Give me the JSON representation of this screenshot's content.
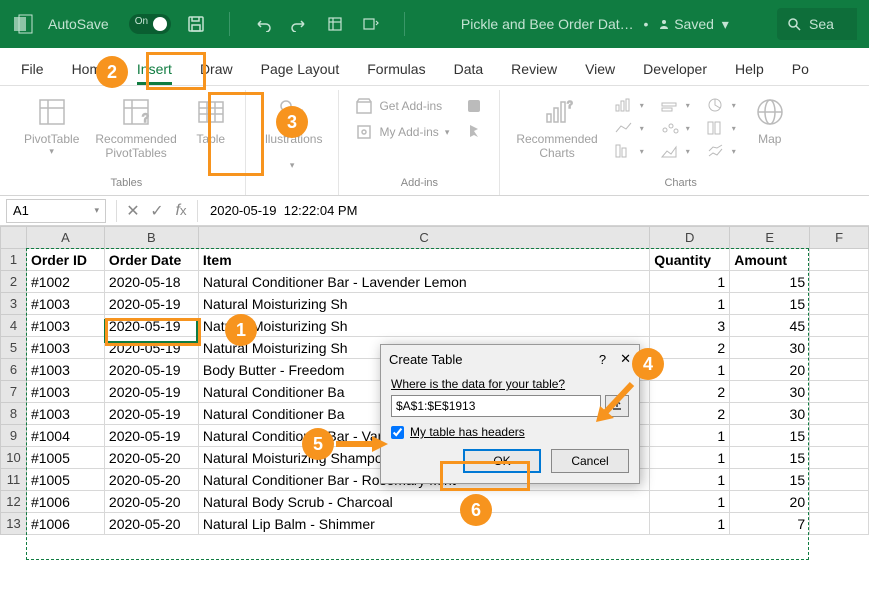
{
  "titlebar": {
    "autosave_label": "AutoSave",
    "autosave_toggle": "On",
    "filename": "Pickle and Bee Order Dat…",
    "saved_status": "Saved",
    "search_label": "Sea"
  },
  "menu": {
    "tabs": [
      "File",
      "Home",
      "Insert",
      "Draw",
      "Page Layout",
      "Formulas",
      "Data",
      "Review",
      "View",
      "Developer",
      "Help",
      "Po"
    ],
    "active_index": 2
  },
  "ribbon": {
    "groups": [
      {
        "label": "Tables",
        "buttons": [
          {
            "name": "pivottable",
            "label": "PivotTable"
          },
          {
            "name": "recommended-pivottables",
            "label": "Recommended\nPivotTables"
          },
          {
            "name": "table",
            "label": "Table"
          }
        ]
      },
      {
        "label": "",
        "buttons": [
          {
            "name": "illustrations",
            "label": "Illustrations"
          }
        ]
      },
      {
        "label": "Add-ins",
        "small": [
          {
            "name": "get-addins",
            "label": "Get Add-ins"
          },
          {
            "name": "my-addins",
            "label": "My Add-ins"
          }
        ]
      },
      {
        "label": "Charts",
        "buttons": [
          {
            "name": "recommended-charts",
            "label": "Recommended\nCharts"
          }
        ],
        "extra": [
          {
            "name": "maps",
            "label": "Map"
          }
        ]
      }
    ]
  },
  "formula_bar": {
    "name_box": "A1",
    "formula": "2020-05-19  12:22:04 PM"
  },
  "columns": [
    "",
    "A",
    "B",
    "C",
    "D",
    "E",
    "F"
  ],
  "headers": [
    "Order ID",
    "Order Date",
    "Item",
    "Quantity",
    "Amount"
  ],
  "rows": [
    {
      "n": 2,
      "id": "#1002",
      "date": "2020-05-18",
      "item": "Natural Conditioner Bar - Lavender Lemon",
      "qty": 1,
      "amt": 15
    },
    {
      "n": 3,
      "id": "#1003",
      "date": "2020-05-19",
      "item": "Natural Moisturizing Sh",
      "qty": 1,
      "amt": 15
    },
    {
      "n": 4,
      "id": "#1003",
      "date": "2020-05-19",
      "item": "Natural Moisturizing Sh",
      "qty": 3,
      "amt": 45
    },
    {
      "n": 5,
      "id": "#1003",
      "date": "2020-05-19",
      "item": "Natural Moisturizing Sh",
      "qty": 2,
      "amt": 30
    },
    {
      "n": 6,
      "id": "#1003",
      "date": "2020-05-19",
      "item": "Body Butter - Freedom",
      "qty": 1,
      "amt": 20
    },
    {
      "n": 7,
      "id": "#1003",
      "date": "2020-05-19",
      "item": "Natural Conditioner Ba",
      "qty": 2,
      "amt": 30
    },
    {
      "n": 8,
      "id": "#1003",
      "date": "2020-05-19",
      "item": "Natural Conditioner Ba",
      "qty": 2,
      "amt": 30
    },
    {
      "n": 9,
      "id": "#1004",
      "date": "2020-05-19",
      "item": "Natural Conditioner Bar - Vanilla Citrus",
      "qty": 1,
      "amt": 15
    },
    {
      "n": 10,
      "id": "#1005",
      "date": "2020-05-20",
      "item": "Natural Moisturizing Shampoo Bar - Tea Tree",
      "qty": 1,
      "amt": 15
    },
    {
      "n": 11,
      "id": "#1005",
      "date": "2020-05-20",
      "item": "Natural Conditioner Bar - Rosemary Mint",
      "qty": 1,
      "amt": 15
    },
    {
      "n": 12,
      "id": "#1006",
      "date": "2020-05-20",
      "item": "Natural Body Scrub - Charcoal",
      "qty": 1,
      "amt": 20
    },
    {
      "n": 13,
      "id": "#1006",
      "date": "2020-05-20",
      "item": "Natural Lip Balm - Shimmer",
      "qty": 1,
      "amt": 7
    }
  ],
  "dialog": {
    "title": "Create Table",
    "prompt": "Where is the data for your table?",
    "range": "$A$1:$E$1913",
    "checkbox_label": "My table has headers",
    "checkbox_checked": true,
    "ok": "OK",
    "cancel": "Cancel"
  },
  "callouts": {
    "c1": "1",
    "c2": "2",
    "c3": "3",
    "c4": "4",
    "c5": "5",
    "c6": "6"
  }
}
